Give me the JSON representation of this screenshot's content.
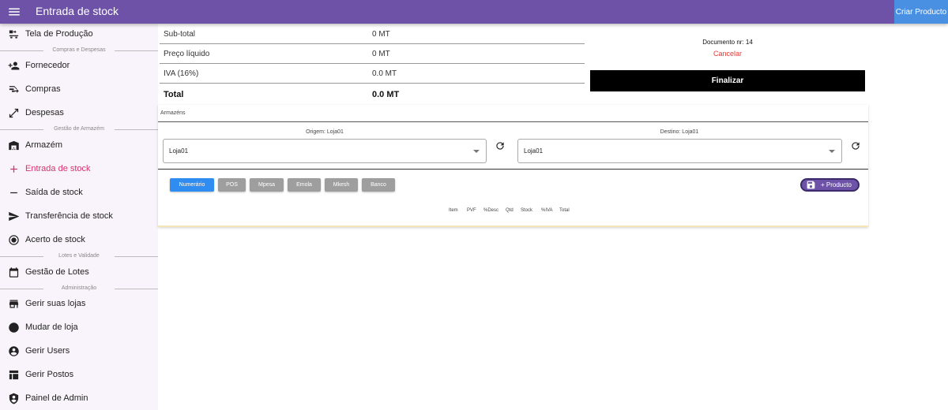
{
  "header": {
    "title": "Entrada de stock",
    "create_product_label": "Criar Producto",
    "colors": {
      "bar": "#6d52a8",
      "create_button": "#4a90e2"
    }
  },
  "sidebar": {
    "items": [
      {
        "label": "Tela de Produção",
        "icon": "production-icon"
      },
      {
        "label": "Fornecedor",
        "icon": "person-add-icon"
      },
      {
        "label": "Compras",
        "icon": "cart-arrow-icon"
      },
      {
        "label": "Despesas",
        "icon": "expand-arrow-icon"
      },
      {
        "label": "Armazém",
        "icon": "warehouse-icon"
      },
      {
        "label": "Entrada de stock",
        "icon": "plus-icon",
        "active": true
      },
      {
        "label": "Saída de stock",
        "icon": "minus-icon"
      },
      {
        "label": "Transferência de stock",
        "icon": "send-icon"
      },
      {
        "label": "Acerto de stock",
        "icon": "target-icon"
      },
      {
        "label": "Gestão de Lotes",
        "icon": "calendar-icon"
      },
      {
        "label": "Gerir suas lojas",
        "icon": "store-icon"
      },
      {
        "label": "Mudar de loja",
        "icon": "swap-icon"
      },
      {
        "label": "Gerir Users",
        "icon": "account-circle-icon"
      },
      {
        "label": "Gerir Postos",
        "icon": "table-icon"
      },
      {
        "label": "Painel de Admin",
        "icon": "admin-shield-icon"
      }
    ],
    "sections": [
      "Compras e Despesas",
      "Gestão de Armazém",
      "Lotes e Validade",
      "Administração"
    ],
    "active_color": "#d6336c"
  },
  "summary": {
    "subtotal_label": "Sub-total",
    "subtotal_value": "0 MT",
    "net_price_label": "Preço líquido",
    "net_price_value": "0 MT",
    "vat_label": "IVA (16%)",
    "vat_value": "0.0 MT",
    "total_label": "Total",
    "total_value": "0.0 MT"
  },
  "document": {
    "number_text": "Documento nr: 14",
    "cancel_label": "Cancelar",
    "finalize_label": "Finalizar"
  },
  "warehouses": {
    "title": "Armazéns",
    "origin_label": "Origem: Loja01",
    "origin_value": "Loja01",
    "destination_label": "Destino: Loja01",
    "destination_value": "Loja01"
  },
  "payment_methods": [
    {
      "label": "Numerário",
      "selected": true
    },
    {
      "label": "POS"
    },
    {
      "label": "Mpesa"
    },
    {
      "label": "Emola"
    },
    {
      "label": "Mkesh"
    },
    {
      "label": "Banco"
    }
  ],
  "add_product_label": "+ Producto",
  "table": {
    "columns": [
      "Item",
      "PVF",
      "%Desc",
      "Qtd",
      "Stock",
      "%IVA",
      "Total"
    ]
  }
}
